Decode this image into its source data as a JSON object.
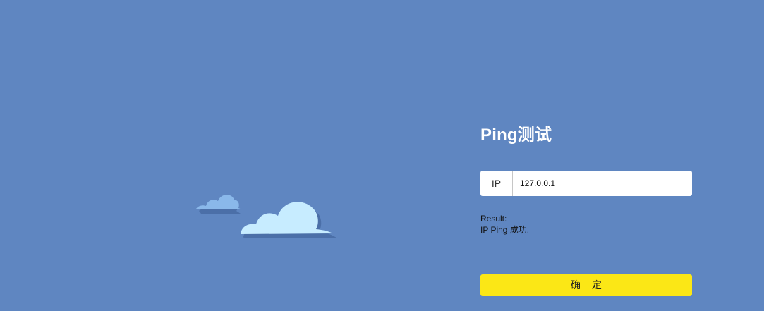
{
  "page": {
    "title": "Ping测试"
  },
  "ip_field": {
    "label": "IP",
    "value": "127.0.0.1"
  },
  "result": {
    "label": "Result:",
    "message": "IP Ping 成功."
  },
  "actions": {
    "confirm_label": "确 定"
  },
  "colors": {
    "background": "#5f86c1",
    "cloud": "#c7ecff",
    "cloud_shadow": "#4b6fa8",
    "button": "#fbe716"
  },
  "icons": {
    "small_cloud": "cloud-icon",
    "large_cloud": "cloud-icon"
  }
}
